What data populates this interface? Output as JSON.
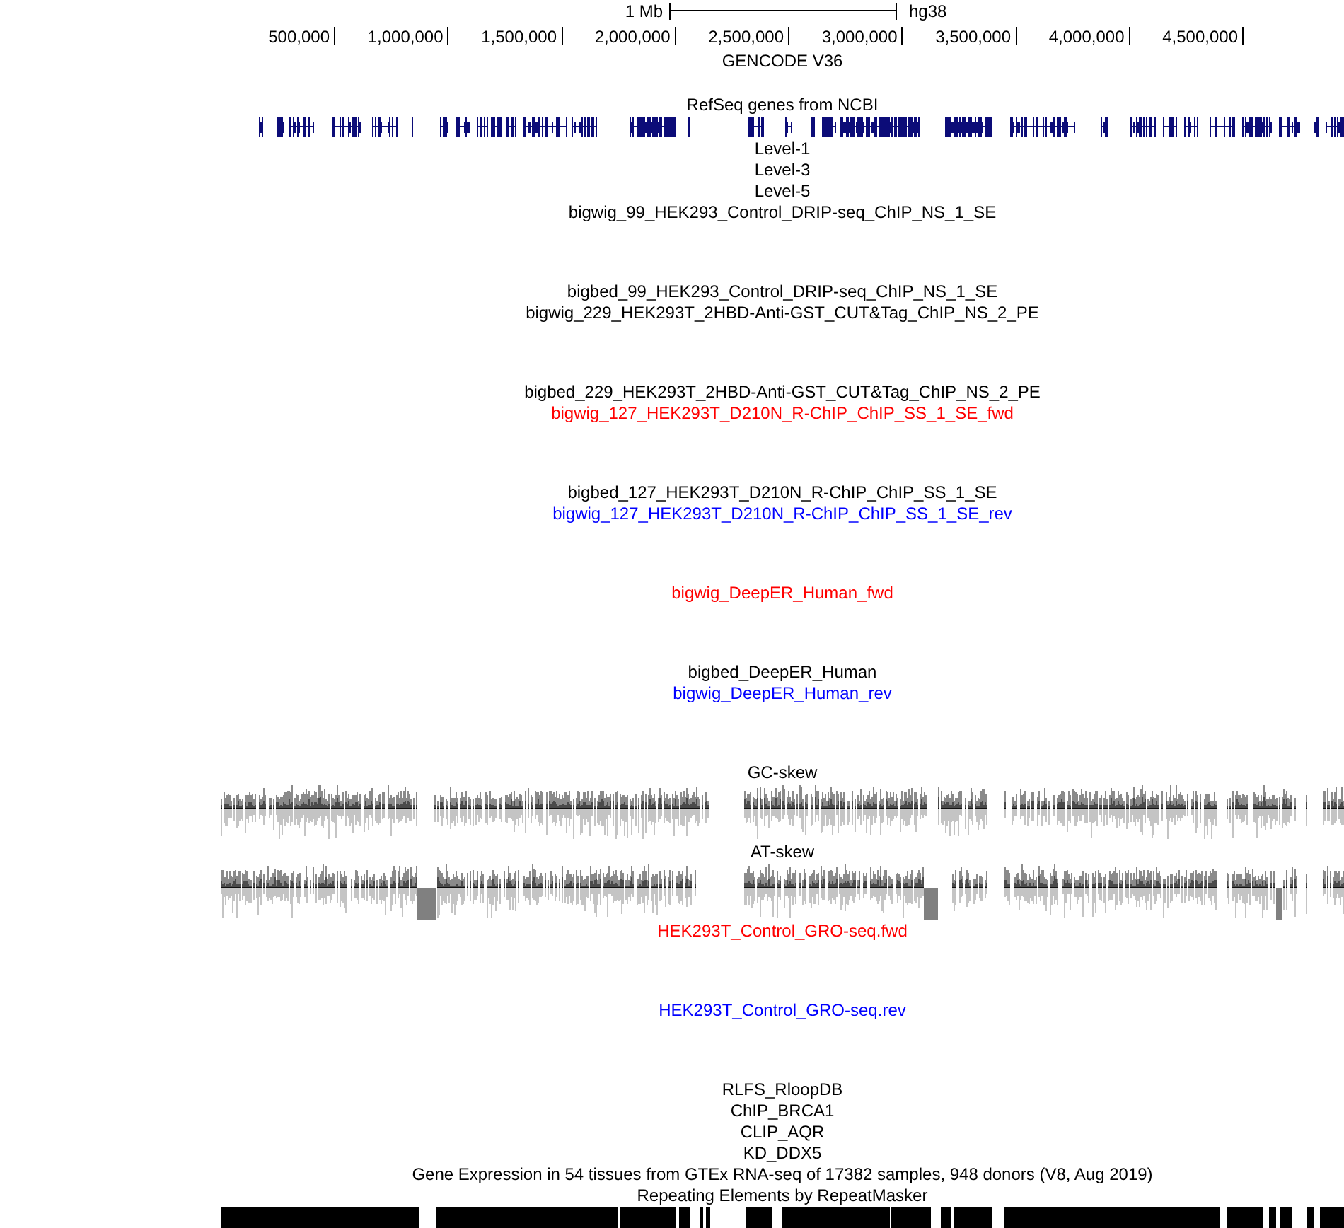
{
  "ruler": {
    "scale_label": "1 Mb",
    "assembly": "hg38",
    "ticks": [
      "500,000",
      "1,000,000",
      "1,500,000",
      "2,000,000",
      "2,500,000",
      "3,000,000",
      "3,500,000",
      "4,000,000",
      "4,500,000"
    ]
  },
  "tracks": [
    {
      "label": "GENCODE V36",
      "kind": "annotation",
      "color": "#000000"
    },
    {
      "label": "RefSeq genes from NCBI",
      "kind": "genes",
      "color": "#000000"
    },
    {
      "label": "Level-1",
      "kind": "label",
      "color": "#000000"
    },
    {
      "label": "Level-3",
      "kind": "label",
      "color": "#000000"
    },
    {
      "label": "Level-5",
      "kind": "label",
      "color": "#000000"
    },
    {
      "label": "bigwig_99_HEK293_Control_DRIP-seq_ChIP_NS_1_SE",
      "kind": "signal",
      "color": "#000000"
    },
    {
      "label": "bigbed_99_HEK293_Control_DRIP-seq_ChIP_NS_1_SE",
      "kind": "label",
      "color": "#000000"
    },
    {
      "label": "bigwig_229_HEK293T_2HBD-Anti-GST_CUT&Tag_ChIP_NS_2_PE",
      "kind": "signal",
      "color": "#000000"
    },
    {
      "label": "bigbed_229_HEK293T_2HBD-Anti-GST_CUT&Tag_ChIP_NS_2_PE",
      "kind": "label",
      "color": "#000000"
    },
    {
      "label": "bigwig_127_HEK293T_D210N_R-ChIP_ChIP_SS_1_SE_fwd",
      "kind": "signal",
      "color": "#ff0000"
    },
    {
      "label": "bigbed_127_HEK293T_D210N_R-ChIP_ChIP_SS_1_SE",
      "kind": "label",
      "color": "#000000"
    },
    {
      "label": "bigwig_127_HEK293T_D210N_R-ChIP_ChIP_SS_1_SE_rev",
      "kind": "signal",
      "color": "#0000ff"
    },
    {
      "label": "bigwig_DeepER_Human_fwd",
      "kind": "signal",
      "color": "#ff0000"
    },
    {
      "label": "bigbed_DeepER_Human",
      "kind": "label",
      "color": "#000000"
    },
    {
      "label": "bigwig_DeepER_Human_rev",
      "kind": "signal",
      "color": "#0000ff"
    },
    {
      "label": "GC-skew",
      "kind": "skew",
      "color": "#000000"
    },
    {
      "label": "AT-skew",
      "kind": "skew",
      "color": "#000000"
    },
    {
      "label": "HEK293T_Control_GRO-seq.fwd",
      "kind": "signal",
      "color": "#ff0000"
    },
    {
      "label": "HEK293T_Control_GRO-seq.rev",
      "kind": "signal",
      "color": "#0000ff"
    },
    {
      "label": "RLFS_RloopDB",
      "kind": "label",
      "color": "#000000"
    },
    {
      "label": "ChIP_BRCA1",
      "kind": "label",
      "color": "#000000"
    },
    {
      "label": "CLIP_AQR",
      "kind": "label",
      "color": "#000000"
    },
    {
      "label": "KD_DDX5",
      "kind": "label",
      "color": "#000000"
    },
    {
      "label": "Gene Expression in 54 tissues from GTEx RNA-seq of 17382 samples, 948 donors (V8, Aug 2019)",
      "kind": "label",
      "color": "#000000"
    },
    {
      "label": "Repeating Elements by RepeatMasker",
      "kind": "repeats",
      "color": "#000000"
    }
  ]
}
